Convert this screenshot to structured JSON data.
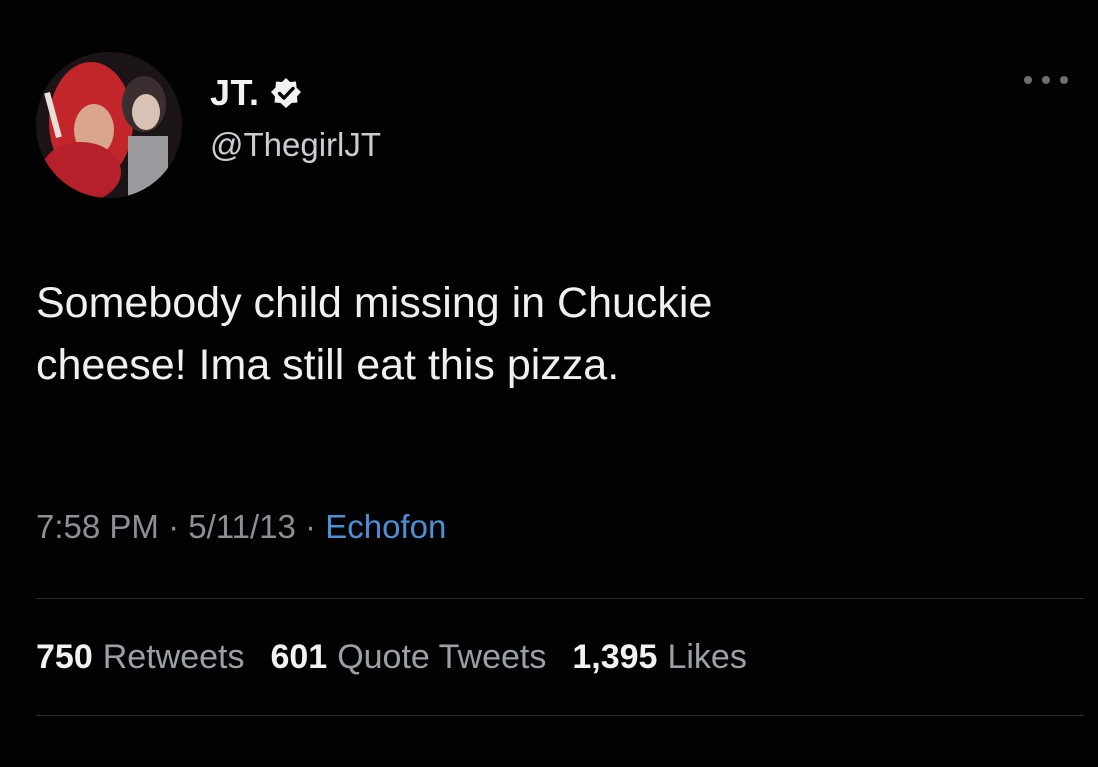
{
  "author": {
    "display_name": "JT.",
    "handle": "@ThegirlJT",
    "verified_icon": "verified-badge-icon"
  },
  "tweet": {
    "text_line1": "Somebody child missing in Chuckie",
    "text_line2": "cheese! Ima still eat this pizza."
  },
  "meta": {
    "time": "7:58 PM",
    "separator1": " · ",
    "date": "5/11/13",
    "separator2": " · ",
    "source": "Echofon"
  },
  "stats": {
    "retweets_count": "750",
    "retweets_label": "Retweets",
    "quotes_count": "601",
    "quotes_label": "Quote Tweets",
    "likes_count": "1,395",
    "likes_label": "Likes"
  },
  "colors": {
    "background": "#020203",
    "link": "#4b8fd6",
    "muted": "#8b9096"
  }
}
